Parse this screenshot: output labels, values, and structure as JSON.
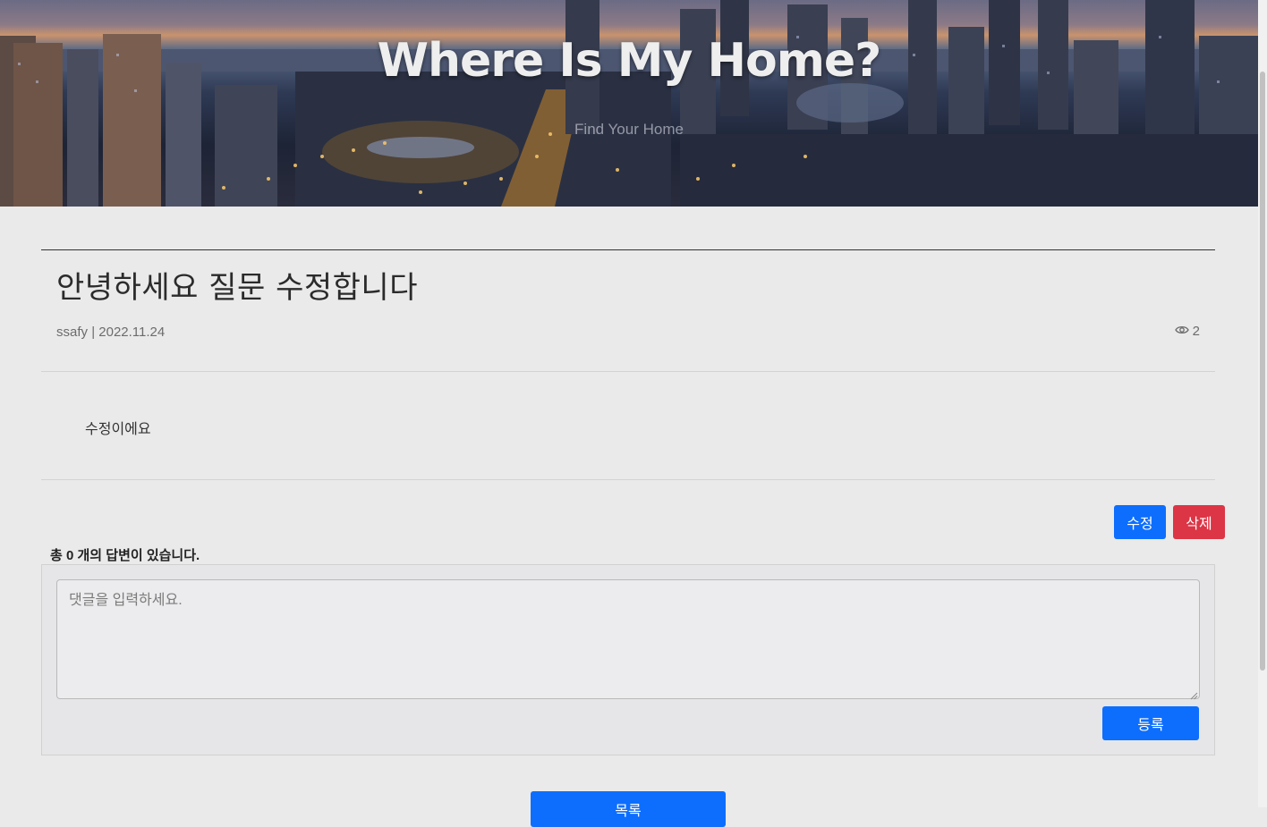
{
  "hero": {
    "title": "Where Is My Home?",
    "subtitle": "Find Your Home"
  },
  "article": {
    "title": "안녕하세요 질문 수정합니다",
    "author": "ssafy",
    "separator": "|",
    "date": "2022.11.24",
    "view_count": "2",
    "view_icon": "eye-icon",
    "body": "수정이에요"
  },
  "actions": {
    "edit_label": "수정",
    "delete_label": "삭제"
  },
  "answers": {
    "prefix": "총",
    "count": "0",
    "suffix": "개의 답변이 있습니다."
  },
  "comment": {
    "placeholder": "댓글을 입력하세요.",
    "value": "",
    "submit_label": "등록"
  },
  "footer": {
    "list_label": "목록"
  },
  "colors": {
    "primary": "#0d6efd",
    "danger": "#dc3545",
    "page_background": "#eaeaea"
  }
}
